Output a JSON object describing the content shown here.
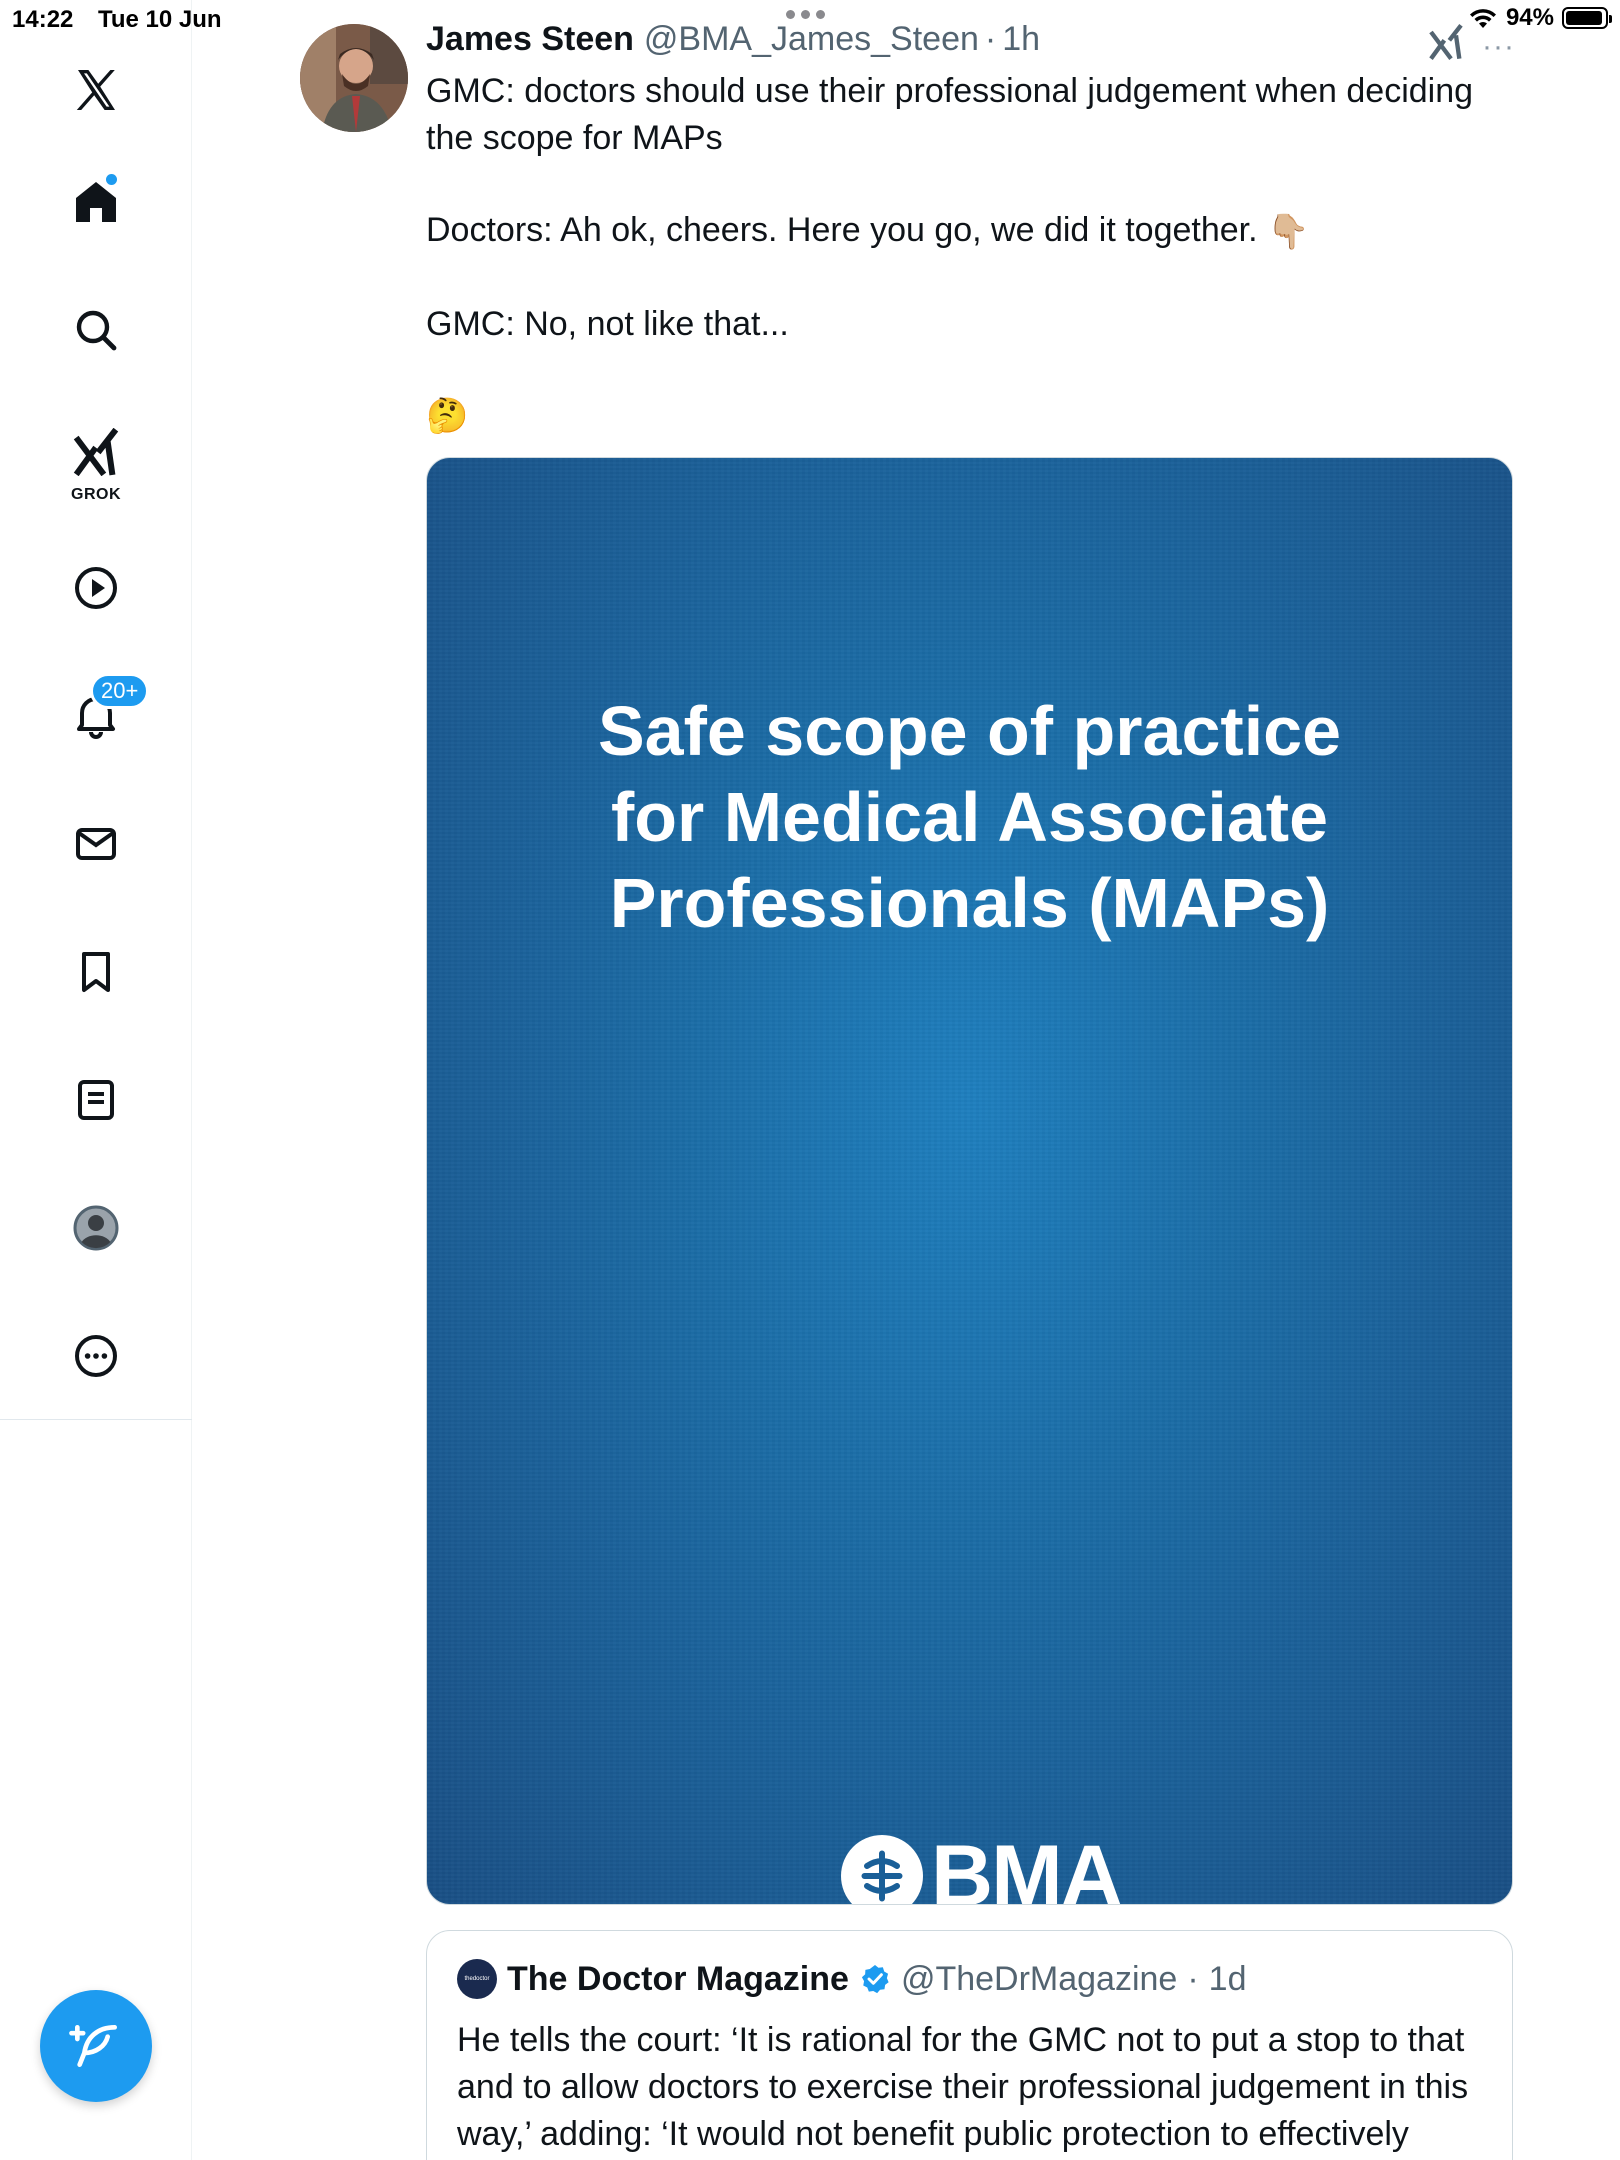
{
  "status_bar": {
    "time": "14:22",
    "date": "Tue 10 Jun",
    "battery": "94%",
    "battery_level": 0.94
  },
  "sidebar": {
    "items": [
      {
        "name": "x-logo",
        "label": ""
      },
      {
        "name": "home",
        "label": ""
      },
      {
        "name": "search",
        "label": ""
      },
      {
        "name": "grok",
        "label": "GROK"
      },
      {
        "name": "video",
        "label": ""
      },
      {
        "name": "notifications",
        "label": "20+"
      },
      {
        "name": "messages",
        "label": ""
      },
      {
        "name": "bookmarks",
        "label": ""
      },
      {
        "name": "lists",
        "label": ""
      },
      {
        "name": "profile",
        "label": ""
      },
      {
        "name": "more",
        "label": ""
      }
    ],
    "notifications_badge": "20+",
    "grok_label": "GROK"
  },
  "tweet": {
    "author_name": "James Steen",
    "handle": "@BMA_James_Steen",
    "separator": "·",
    "time": "1h",
    "more": "···",
    "lines": {
      "p1": "GMC: doctors should use their professional judgement when deciding the scope for MAPs",
      "p2": "Doctors: Ah ok, cheers. Here you go, we did it together.",
      "p2_emoji": "👇🏼",
      "p3": "GMC: No, not like that...",
      "p4_emoji": "🤔"
    },
    "media": {
      "title_line1": "Safe scope of practice",
      "title_line2": "for Medical Associate",
      "title_line3": "Professionals (MAPs)",
      "logo_text": "BMA"
    }
  },
  "quote": {
    "author_name": "The Doctor Magazine",
    "handle": "@TheDrMagazine",
    "separator": "·",
    "time": "1d",
    "avatar_text": "thedoctor",
    "body": "He tells the court: ‘It is rational for the GMC not to put a stop to that and to allow doctors to exercise their professional judgement in this way,’ adding: ‘It would not benefit public protection to effectively"
  },
  "colors": {
    "accent": "#1d9bf0",
    "text": "#0f1419",
    "muted": "#536471",
    "media_blue": "#1b6ea8"
  }
}
